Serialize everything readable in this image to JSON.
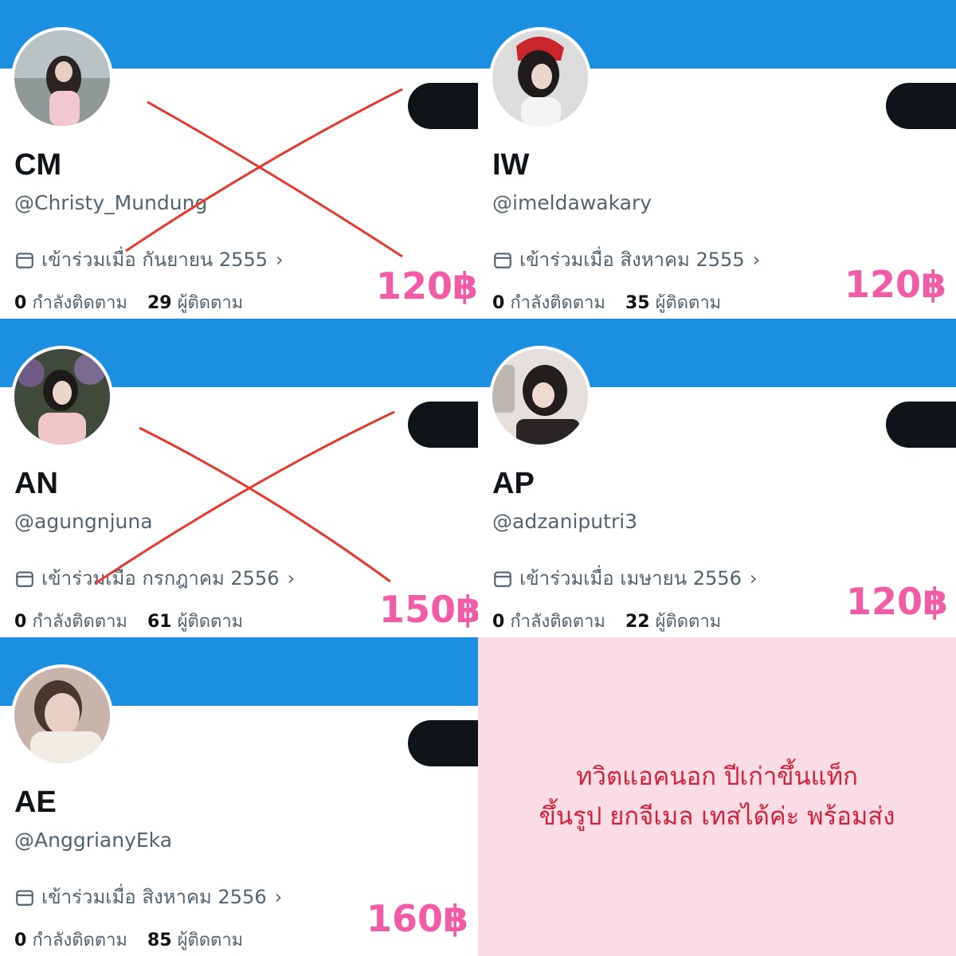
{
  "cards": [
    {
      "name": "CM",
      "handle": "@Christy_Mundung",
      "joined": "เข้าร่วมเมื่อ กันยายน 2555",
      "following_count": "0",
      "following_label": "กำลังติดตาม",
      "followers_count": "29",
      "followers_label": "ผู้ติดตาม",
      "price": "120฿",
      "crossed_out": true
    },
    {
      "name": "IW",
      "handle": "@imeldawakary",
      "joined": "เข้าร่วมเมื่อ สิงหาคม 2555",
      "following_count": "0",
      "following_label": "กำลังติดตาม",
      "followers_count": "35",
      "followers_label": "ผู้ติดตาม",
      "price": "120฿",
      "crossed_out": false
    },
    {
      "name": "AN",
      "handle": "@agungnjuna",
      "joined": "เข้าร่วมเมื่อ กรกฎาคม 2556",
      "following_count": "0",
      "following_label": "กำลังติดตาม",
      "followers_count": "61",
      "followers_label": "ผู้ติดตาม",
      "price": "150฿",
      "crossed_out": true
    },
    {
      "name": "AP",
      "handle": "@adzaniputri3",
      "joined": "เข้าร่วมเมื่อ เมษายน 2556",
      "following_count": "0",
      "following_label": "กำลังติดตาม",
      "followers_count": "22",
      "followers_label": "ผู้ติดตาม",
      "price": "120฿",
      "crossed_out": false
    },
    {
      "name": "AE",
      "handle": "@AnggrianyEka",
      "joined": "เข้าร่วมเมื่อ สิงหาคม 2556",
      "following_count": "0",
      "following_label": "กำลังติดตาม",
      "followers_count": "85",
      "followers_label": "ผู้ติดตาม",
      "price": "160฿",
      "crossed_out": false
    }
  ],
  "promo": {
    "line1": "ทวิตแอคนอก ปีเก่าขึ้นแท็ก",
    "line2": "ขึ้นรูป ยกจีเมล เทสได้ค่ะ พร้อมส่ง"
  },
  "colors": {
    "banner": "#1d8fe0",
    "price": "#f25ba6",
    "cross": "#e8392e",
    "promo_bg": "#f9dce6",
    "promo_text": "#d4213b"
  },
  "icons": {
    "joined": "calendar-icon",
    "more": "chevron-right-icon"
  }
}
